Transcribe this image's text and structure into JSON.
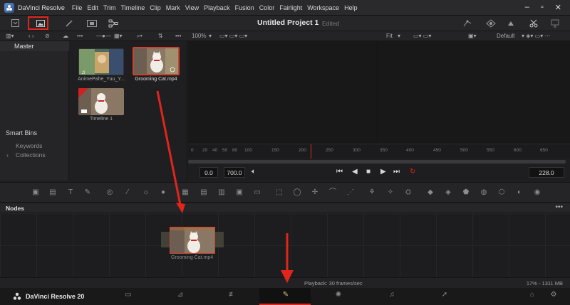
{
  "app": {
    "name": "DaVinci Resolve"
  },
  "menu": [
    "File",
    "Edit",
    "Trim",
    "Timeline",
    "Clip",
    "Mark",
    "View",
    "Playback",
    "Fusion",
    "Color",
    "Fairlight",
    "Workspace",
    "Help"
  ],
  "project": {
    "title": "Untitled Project 1",
    "status": "Edited"
  },
  "toolbar2": {
    "zoom": "100%",
    "fit": "Fit",
    "layout": "Default"
  },
  "bins": {
    "master": "Master",
    "smart_bins": "Smart Bins",
    "keywords": "Keywords",
    "collections": "Collections"
  },
  "media": [
    {
      "name": "AnimePahe_Yuu_Y..."
    },
    {
      "name": "Grooming Cat.mp4"
    },
    {
      "name": "Timeline 1"
    }
  ],
  "ruler_ticks": [
    "0",
    "20",
    "40",
    "50",
    "80",
    "100",
    "150",
    "200",
    "250",
    "300",
    "350",
    "400",
    "450",
    "500",
    "550",
    "600",
    "650"
  ],
  "transport": {
    "in_tc": "0.0",
    "out_tc": "700.0",
    "frame": "228.0"
  },
  "nodes": {
    "title": "Nodes",
    "node_label": "Grooming Cat.mp4"
  },
  "status": {
    "playback": "Playback: 30 frames/sec",
    "memory": "17% - 1311 MB"
  },
  "brand": {
    "label": "DaVinci Resolve 20"
  },
  "colors": {
    "accent_red": "#e1251b"
  }
}
